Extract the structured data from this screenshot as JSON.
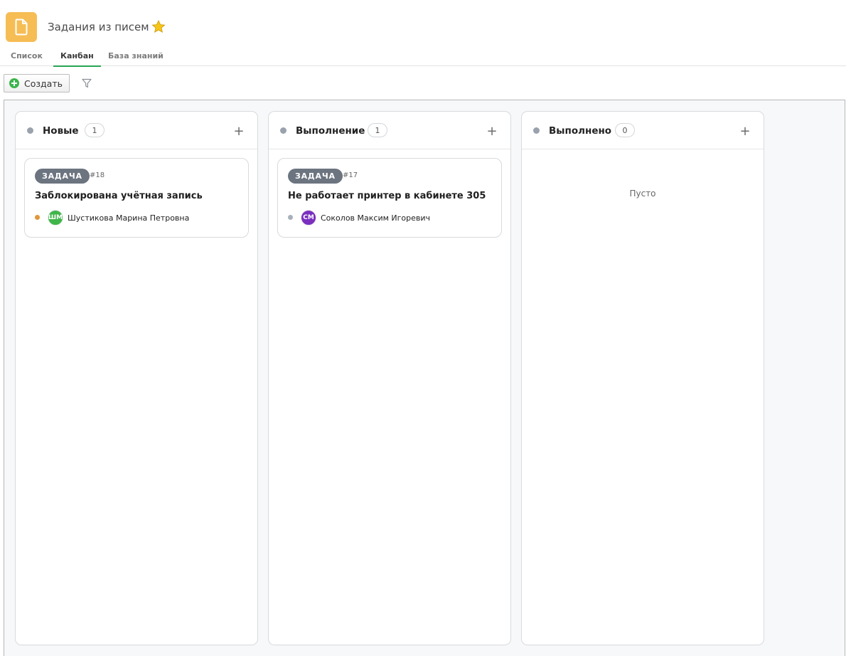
{
  "header": {
    "title": "Задания из писем",
    "app_icon": "document-icon",
    "favorite_icon": "star-icon",
    "colors": {
      "app_icon_bg": "#f6bd55",
      "star": "#f5c518"
    }
  },
  "tabs": [
    {
      "label": "Список",
      "active": false
    },
    {
      "label": "Канбан",
      "active": true
    },
    {
      "label": "База знаний",
      "active": false
    }
  ],
  "toolbar": {
    "create_label": "Создать",
    "filter_icon": "filter-icon"
  },
  "columns": [
    {
      "title": "Новые",
      "count": "1",
      "cards": [
        {
          "tag": "ЗАДАЧА",
          "id": "#18",
          "title": "Заблокирована учётная запись",
          "priority_color": "#e0963a",
          "avatar_initials": "ШМ",
          "avatar_color": "#3fb54a",
          "assignee": "Шустикова Марина Петровна"
        }
      ]
    },
    {
      "title": "Выполнение",
      "count": "1",
      "cards": [
        {
          "tag": "ЗАДАЧА",
          "id": "#17",
          "title": "Не работает принтер в кабинете 305",
          "priority_color": "#a8b0bb",
          "avatar_initials": "СМ",
          "avatar_color": "#7b2fbf",
          "assignee": "Соколов Максим Игоревич"
        }
      ]
    },
    {
      "title": "Выполнено",
      "count": "0",
      "cards": [],
      "empty_text": "Пусто"
    }
  ]
}
